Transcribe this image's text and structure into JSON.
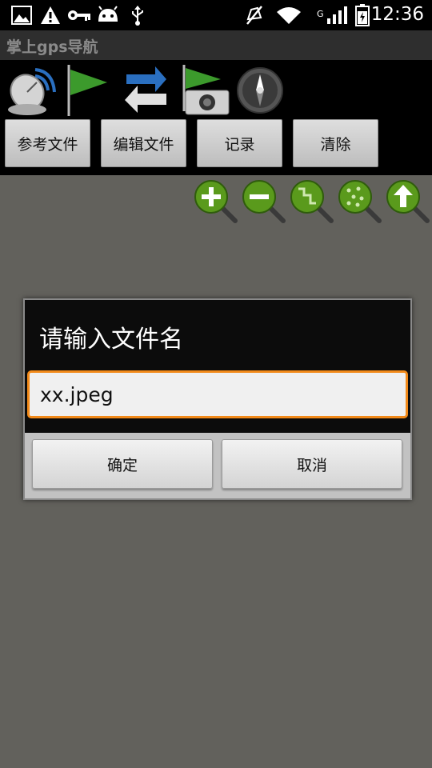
{
  "status_bar": {
    "time": "12:36",
    "network_label": "G",
    "icons": [
      "image-icon",
      "warning-icon",
      "key-icon",
      "android-icon",
      "usb-icon",
      "mute-icon",
      "wifi-icon",
      "signal-icon",
      "battery-icon"
    ]
  },
  "app": {
    "title": "掌上gps导航"
  },
  "toolbar": {
    "icons": [
      "satellite-dish-icon",
      "flag-icon",
      "swap-arrows-icon",
      "flag-camera-icon",
      "compass-icon"
    ],
    "buttons": [
      "参考文件",
      "编辑文件",
      "记录",
      "清除"
    ]
  },
  "map_controls": {
    "icons": [
      "zoom-in-icon",
      "zoom-out-icon",
      "route-zoom-icon",
      "points-zoom-icon",
      "up-zoom-icon"
    ]
  },
  "dialog": {
    "title": "请输入文件名",
    "input_value": "xx.jpeg",
    "confirm_label": "确定",
    "cancel_label": "取消"
  },
  "colors": {
    "background": "#62615c",
    "accent_focus": "#f28a1a",
    "icon_green": "#5a9a1c"
  }
}
